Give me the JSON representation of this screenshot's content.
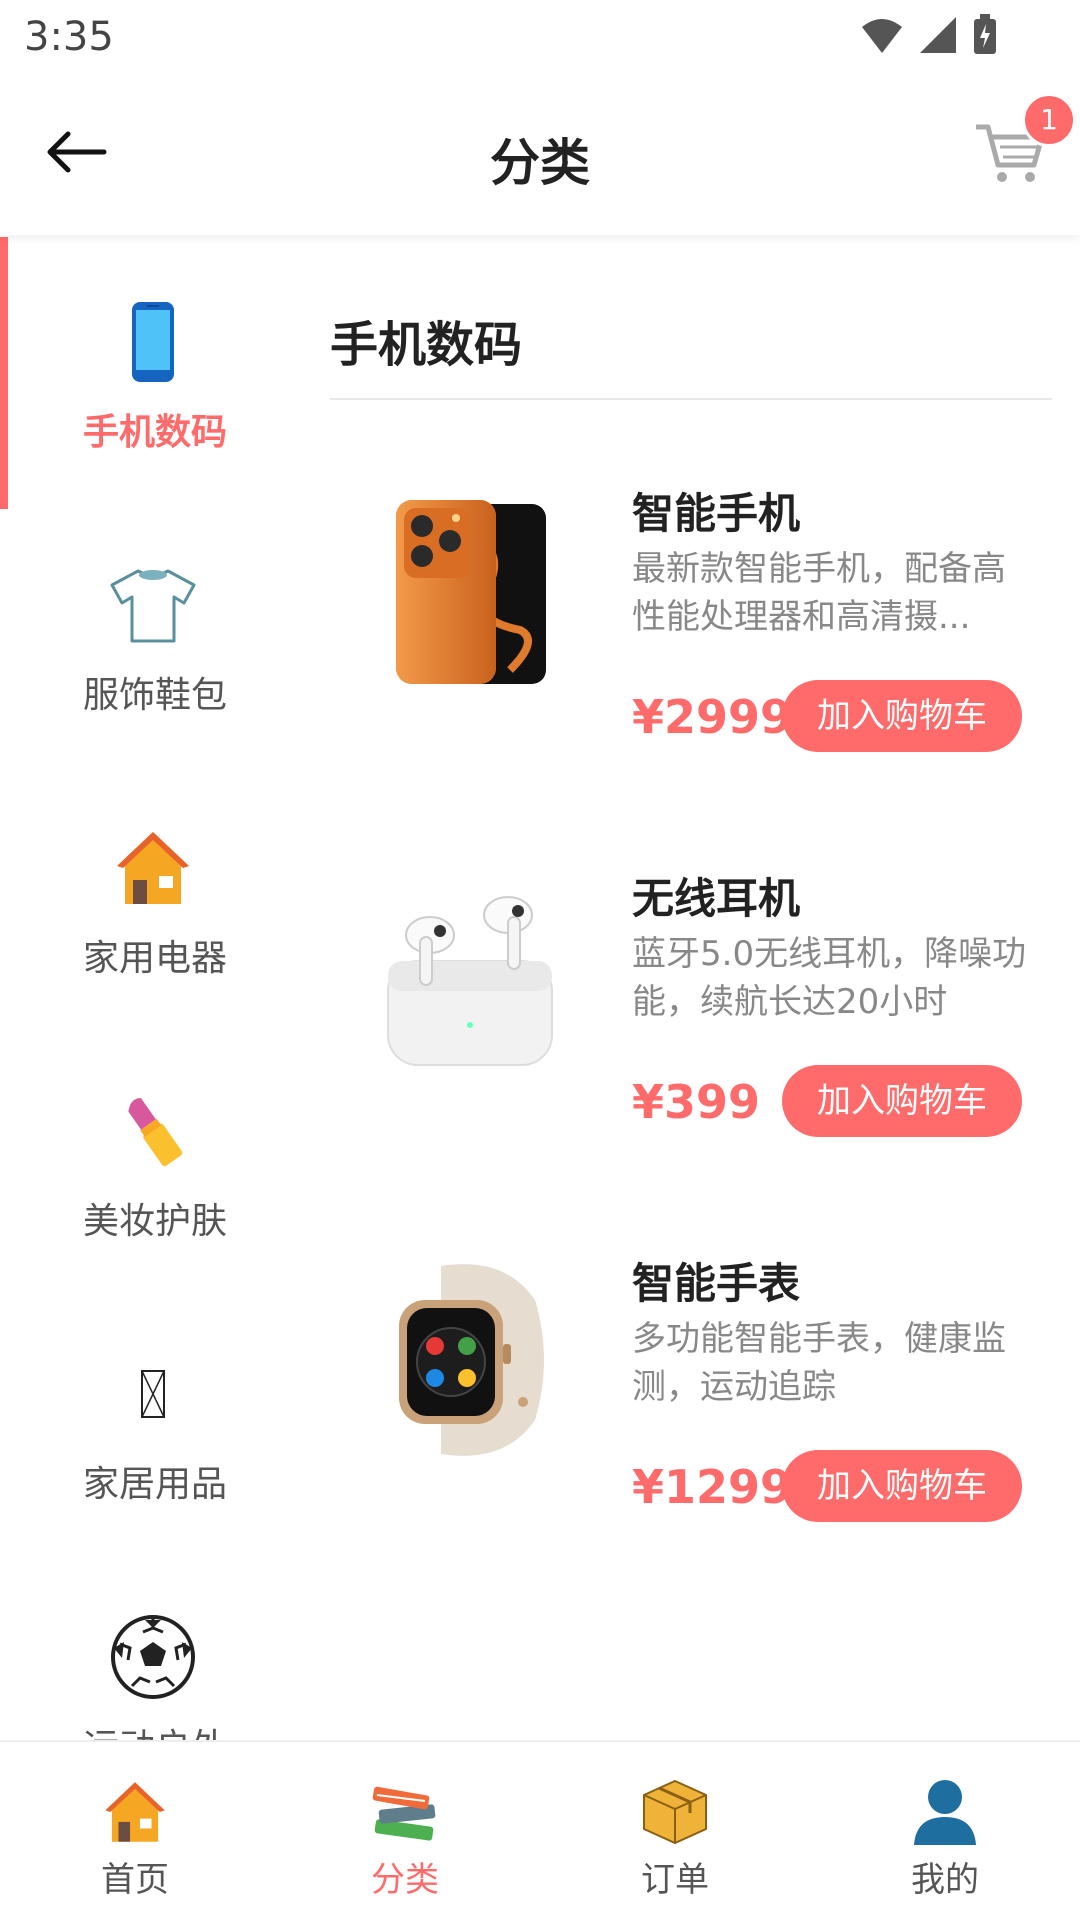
{
  "status": {
    "time": "3:35"
  },
  "header": {
    "title": "分类",
    "cart_badge": "1"
  },
  "sidebar": {
    "items": [
      {
        "label": "手机数码",
        "icon": "phone-icon",
        "active": true
      },
      {
        "label": "服饰鞋包",
        "icon": "tshirt-icon",
        "active": false
      },
      {
        "label": "家用电器",
        "icon": "house-icon",
        "active": false
      },
      {
        "label": "美妆护肤",
        "icon": "lipstick-icon",
        "active": false
      },
      {
        "label": "家居用品",
        "icon": "missing-glyph-icon",
        "active": false
      },
      {
        "label": "运动户外",
        "icon": "soccer-ball-icon",
        "active": false
      }
    ]
  },
  "main": {
    "section_title": "手机数码",
    "products": [
      {
        "name": "智能手机",
        "desc": "最新款智能手机，配备高性能处理器和高清摄...",
        "price": "¥2999",
        "button": "加入购物车",
        "image": "orange-smartphone"
      },
      {
        "name": "无线耳机",
        "desc": "蓝牙5.0无线耳机，降噪功能，续航长达20小时",
        "price": "¥399",
        "button": "加入购物车",
        "image": "wireless-earbuds"
      },
      {
        "name": "智能手表",
        "desc": "多功能智能手表，健康监测，运动追踪",
        "price": "¥1299",
        "button": "加入购物车",
        "image": "smartwatch"
      }
    ]
  },
  "bottom_nav": {
    "tabs": [
      {
        "label": "首页",
        "icon": "house-icon",
        "active": false
      },
      {
        "label": "分类",
        "icon": "books-icon",
        "active": true
      },
      {
        "label": "订单",
        "icon": "box-icon",
        "active": false
      },
      {
        "label": "我的",
        "icon": "user-icon",
        "active": false
      }
    ]
  },
  "colors": {
    "accent": "#ff6b6b",
    "text": "#222222",
    "muted": "#888888"
  }
}
